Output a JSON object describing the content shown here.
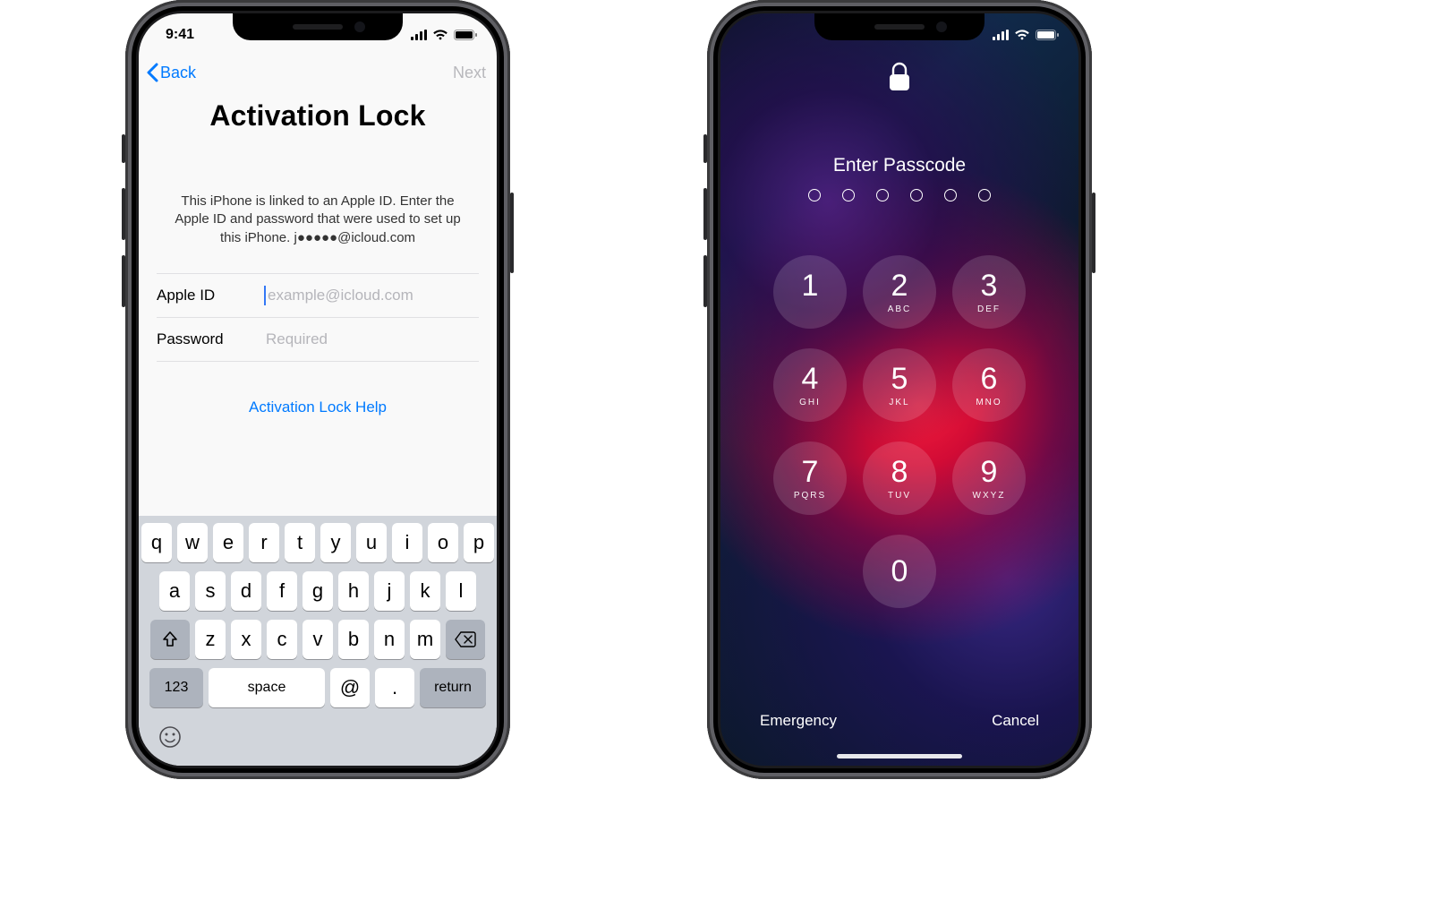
{
  "left": {
    "status": {
      "time": "9:41"
    },
    "nav": {
      "back": "Back",
      "next": "Next"
    },
    "title": "Activation Lock",
    "description": "This iPhone is linked to an Apple ID. Enter the Apple ID and password that were used to set up this iPhone. j●●●●●@icloud.com",
    "fields": {
      "appleid_label": "Apple ID",
      "appleid_placeholder": "example@icloud.com",
      "password_label": "Password",
      "password_placeholder": "Required"
    },
    "help_link": "Activation Lock Help",
    "keyboard": {
      "util123": "123",
      "space": "space",
      "at": "@",
      "dot": ".",
      "ret": "return"
    }
  },
  "right": {
    "title": "Enter Passcode",
    "digits": 6,
    "pad": [
      {
        "n": "1",
        "l": ""
      },
      {
        "n": "2",
        "l": "ABC"
      },
      {
        "n": "3",
        "l": "DEF"
      },
      {
        "n": "4",
        "l": "GHI"
      },
      {
        "n": "5",
        "l": "JKL"
      },
      {
        "n": "6",
        "l": "MNO"
      },
      {
        "n": "7",
        "l": "PQRS"
      },
      {
        "n": "8",
        "l": "TUV"
      },
      {
        "n": "9",
        "l": "WXYZ"
      },
      {
        "n": "0",
        "l": ""
      }
    ],
    "emergency": "Emergency",
    "cancel": "Cancel"
  }
}
